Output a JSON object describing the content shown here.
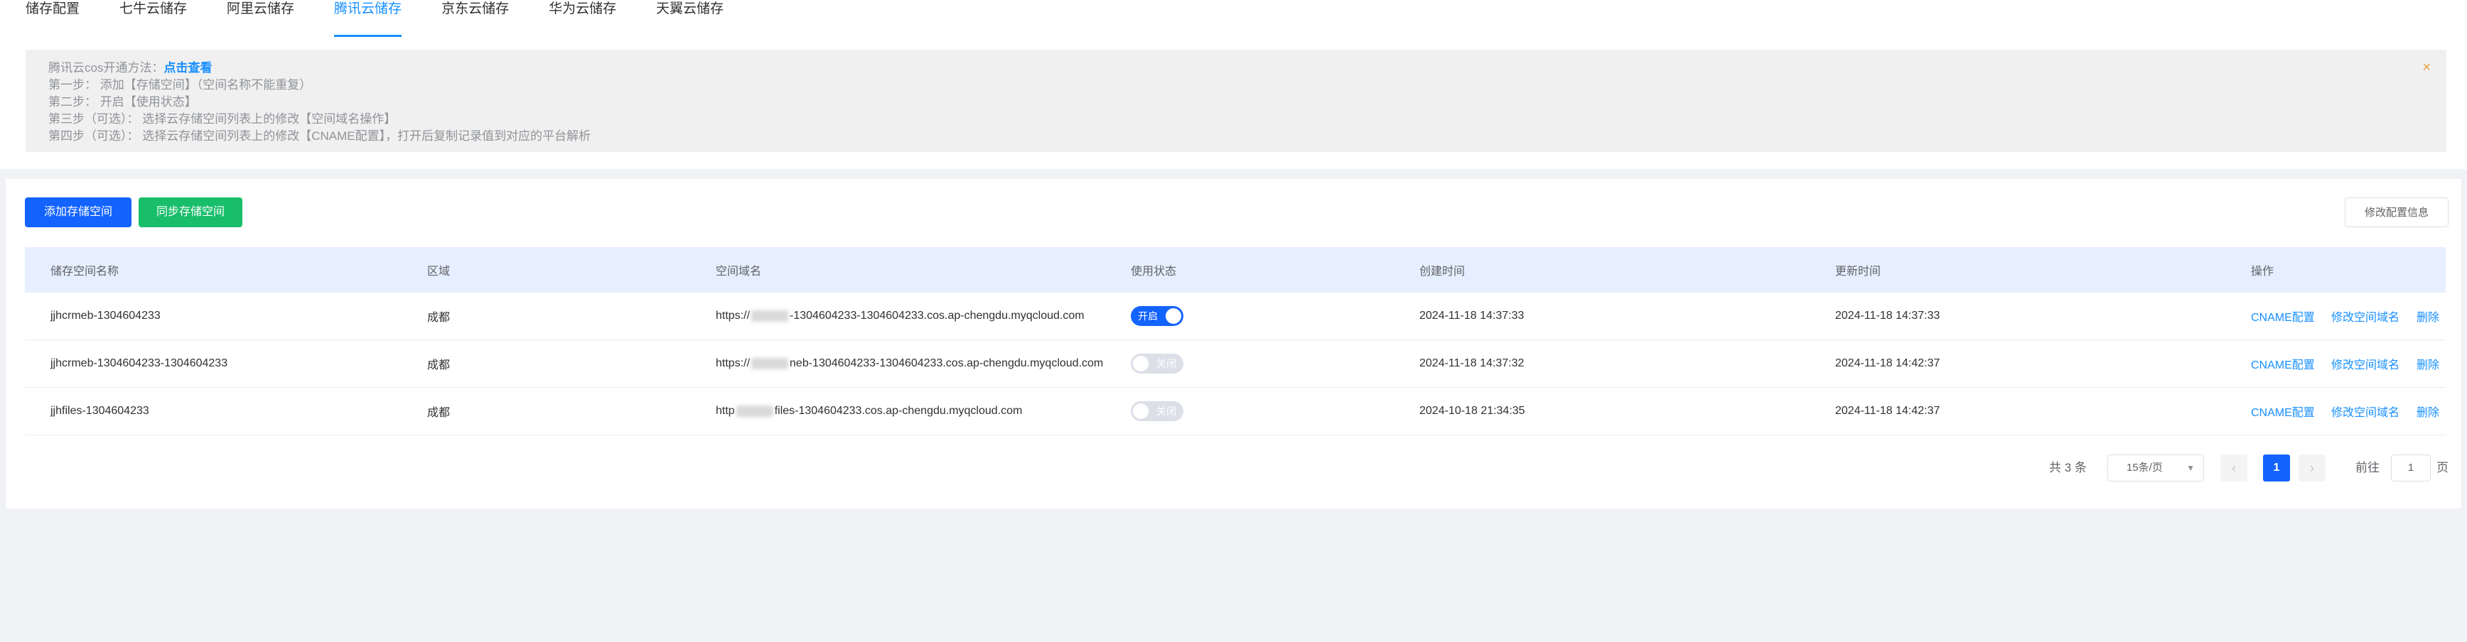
{
  "tabs": [
    {
      "label": "储存配置",
      "active": false
    },
    {
      "label": "七牛云储存",
      "active": false
    },
    {
      "label": "阿里云储存",
      "active": false
    },
    {
      "label": "腾讯云储存",
      "active": true
    },
    {
      "label": "京东云储存",
      "active": false
    },
    {
      "label": "华为云储存",
      "active": false
    },
    {
      "label": "天翼云储存",
      "active": false
    }
  ],
  "tip": {
    "intro": "腾讯云cos开通方法：",
    "link": "点击查看",
    "steps": [
      "第一步： 添加【存储空间】（空间名称不能重复）",
      "第二步： 开启【使用状态】",
      "第三步（可选）： 选择云存储空间列表上的修改【空间域名操作】",
      "第四步（可选）： 选择云存储空间列表上的修改【CNAME配置】，打开后复制记录值到对应的平台解析"
    ],
    "close_icon": "×"
  },
  "toolbar": {
    "add_label": "添加存储空间",
    "sync_label": "同步存储空间",
    "edit_label": "修改配置信息",
    "add_color": "#1363ff",
    "sync_color": "#19be6b"
  },
  "table": {
    "headers": [
      "储存空间名称",
      "区域",
      "空间域名",
      "使用状态",
      "创建时间",
      "更新时间",
      "操作"
    ],
    "rows": [
      {
        "name": "jjhcrmeb-1304604233",
        "region": "成都",
        "domain_prefix": "https://",
        "domain_suffix": "-1304604233-1304604233.cos.ap-chengdu.myqcloud.com",
        "status": "开启",
        "enabled": true,
        "created": "2024-11-18 14:37:33",
        "updated": "2024-11-18 14:37:33"
      },
      {
        "name": "jjhcrmeb-1304604233-1304604233",
        "region": "成都",
        "domain_prefix": "https://",
        "domain_suffix": "neb-1304604233-1304604233.cos.ap-chengdu.myqcloud.com",
        "status": "关闭",
        "enabled": false,
        "created": "2024-11-18 14:37:32",
        "updated": "2024-11-18 14:42:37"
      },
      {
        "name": "jjhfiles-1304604233",
        "region": "成都",
        "domain_prefix": "http",
        "domain_suffix": "files-1304604233.cos.ap-chengdu.myqcloud.com",
        "status": "关闭",
        "enabled": false,
        "created": "2024-10-18 21:34:35",
        "updated": "2024-11-18 14:42:37"
      }
    ],
    "actions": [
      "CNAME配置",
      "修改空间域名",
      "删除"
    ]
  },
  "pagination": {
    "total": "共 3 条",
    "page_size": "15条/页",
    "current_page": "1",
    "goto_label": "前往",
    "goto_value": "1",
    "page_suffix": "页"
  }
}
